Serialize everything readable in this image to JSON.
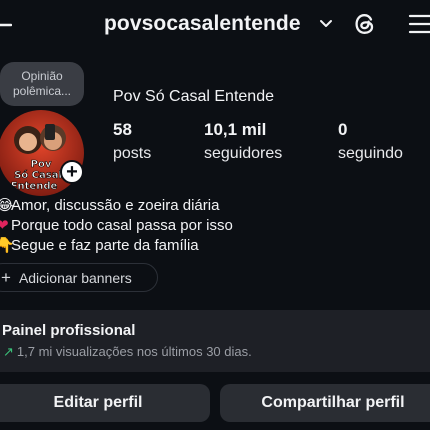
{
  "header": {
    "username": "povsocasalentende",
    "back_icon": "back-arrow-icon",
    "threads_icon": "threads-icon",
    "menu_icon": "hamburger-menu-icon"
  },
  "note": {
    "line1": "Opinião",
    "line2": "polêmica..."
  },
  "avatar": {
    "text_line1": "Pov",
    "text_line2": "Só Casal",
    "text_line3": "Entende"
  },
  "profile": {
    "full_name": "Pov Só Casal Entende",
    "stats": [
      {
        "value": "58",
        "label": "posts"
      },
      {
        "value": "10,1 mil",
        "label": "seguidores"
      },
      {
        "value": "0",
        "label": "seguindo"
      }
    ],
    "bio": [
      {
        "emoji": "😂",
        "text": "Amor, discussão e zoeira diária"
      },
      {
        "emoji": "❤",
        "text": "Porque todo casal passa por isso"
      },
      {
        "emoji": "👇",
        "text": "Segue e faz parte da família"
      }
    ]
  },
  "banners": {
    "label": "Adicionar banners"
  },
  "panel": {
    "title": "Painel profissional",
    "subtitle": "1,7 mi visualizações nos últimos 30 dias.",
    "arrow_color": "#3bc27a"
  },
  "actions": {
    "edit_label": "Editar perfil",
    "share_label": "Compartilhar perfil"
  }
}
